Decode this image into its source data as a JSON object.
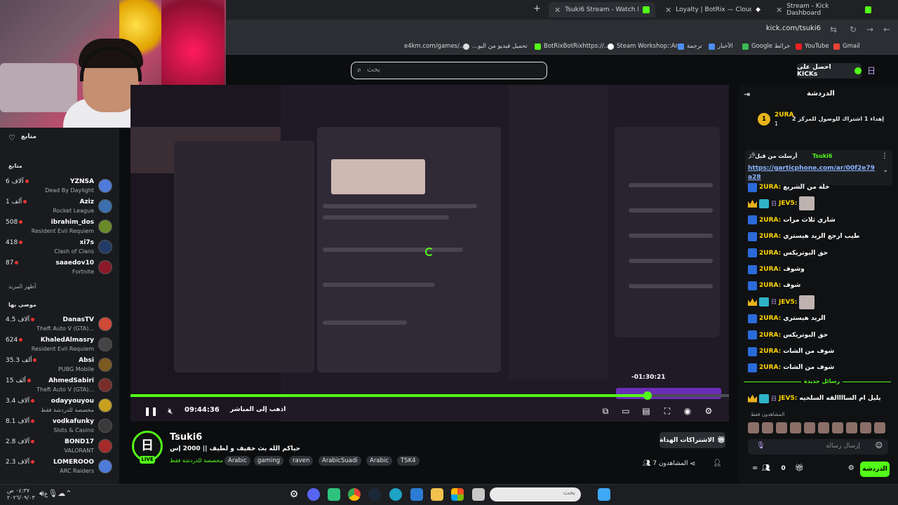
{
  "browser": {
    "tabs": [
      {
        "label": "Tsuki6 Stream - Watch Live on",
        "active": true
      },
      {
        "label": "Loyalty | BotRix — Cloud Stre",
        "active": false
      },
      {
        "label": "Stream - Kick Dashboard",
        "active": false
      }
    ],
    "url": "kick.com/tsuki6",
    "bookmarks": [
      "e4km.com/games/...",
      "...تحميل فيديو من اليو",
      "BotRixBotRixhttps://...",
      "Steam Workshop::Ar...",
      "ترجمة",
      "الأخبار",
      "Google خرائط",
      "YouTube",
      "Gmail"
    ]
  },
  "header": {
    "search_placeholder": "بحث",
    "get_kicks": "احصل على KICKs"
  },
  "sidebar": {
    "title": "متابع",
    "section_following": "متابع",
    "following": [
      {
        "name": "YZNSA",
        "count": "6 آلاف",
        "game": "Dead By Daylight"
      },
      {
        "name": "Aziz",
        "count": "1 ألف",
        "game": "Rocket League"
      },
      {
        "name": "ibrahim_dos",
        "count": "508",
        "game": "Resident Evil Requiem"
      },
      {
        "name": "xi7s",
        "count": "418",
        "game": "Clash of Clans"
      },
      {
        "name": "saaedov10",
        "count": "87",
        "game": "Fortnite"
      }
    ],
    "show_more": "أظهر المزيد",
    "section_recommended": "موصى بها",
    "recommended": [
      {
        "name": "DanasTV",
        "count": "4.5 آلاف",
        "game": "Theft Auto V (GTA)..."
      },
      {
        "name": "KhaledAlmasry",
        "count": "624",
        "game": "Resident Evil Requiem"
      },
      {
        "name": "Absi",
        "count": "35.3 ألف",
        "game": "PUBG Mobile"
      },
      {
        "name": "AhmedSabiri",
        "count": "15 ألف",
        "game": "Theft Auto V (GTA)..."
      },
      {
        "name": "odayyouyou",
        "count": "3.4 آلاف",
        "game": "مخصصة للدردشة فقط"
      },
      {
        "name": "vodkafunky",
        "count": "8.1 آلاف",
        "game": "Slots & Casino"
      },
      {
        "name": "BOND17",
        "count": "2.8 آلاف",
        "game": "VALORANT"
      },
      {
        "name": "LOMEROOO",
        "count": "2.3 آلاف",
        "game": "ARC Raiders"
      }
    ]
  },
  "player": {
    "overlay_time": "-01:30:21",
    "elapsed": "09:44:36",
    "go_live": "اذهب إلى المباشر",
    "progress": 0.864
  },
  "channel": {
    "avatar_text": "日",
    "live": "LIVE",
    "name": "Tsuki6",
    "title": "حياكم الله بث خفيف و لطيف || 2000 إس",
    "category": "مخصصة للدردشة فقط",
    "tags": [
      "Arabic",
      "gaming",
      "raven",
      "ArabicSuadi",
      "Arabic",
      "TSK4"
    ],
    "subs_button": "الاشتراكات الهداة",
    "viewers": "7 المشاهدون"
  },
  "chat": {
    "title": "الدردشة",
    "top_contrib": {
      "rank": "1",
      "name": "2URA",
      "count": "1",
      "goal": "إهداء 1 اشتراك للوصول للمركز 2"
    },
    "pinned": {
      "user": "Tsuki6",
      "by": "أرسلت من قبل",
      "link": "https://garticphone.com/ar/00f2e79a28"
    },
    "messages": [
      {
        "user": "2URA:",
        "color": "#ffd400",
        "text": "خلة من الشريع",
        "badges": [
          "sq"
        ]
      },
      {
        "user": "JEV5:",
        "color": "#ffd400",
        "text": "",
        "badges": [
          "crown",
          "og",
          "pin"
        ],
        "emote": true
      },
      {
        "user": "2URA:",
        "color": "#ffd400",
        "text": "شاري ثلاث مرات",
        "badges": [
          "sq"
        ]
      },
      {
        "user": "2URA:",
        "color": "#ffd400",
        "text": "طيب ارجع الريد هيستري",
        "badges": [
          "sq"
        ]
      },
      {
        "user": "2URA:",
        "color": "#ffd400",
        "text": "حق البوتريكس",
        "badges": [
          "sq"
        ]
      },
      {
        "user": "2URA:",
        "color": "#ffd400",
        "text": "وشوف",
        "badges": [
          "sq"
        ]
      },
      {
        "user": "2URA:",
        "color": "#ffd400",
        "text": "شوف",
        "badges": [
          "sq"
        ]
      },
      {
        "user": "JEV5:",
        "color": "#ffd400",
        "text": "",
        "badges": [
          "crown",
          "og",
          "pin"
        ],
        "emote": true
      },
      {
        "user": "2URA:",
        "color": "#ffd400",
        "text": "الريد هيستري",
        "badges": [
          "sq"
        ]
      },
      {
        "user": "2URA:",
        "color": "#ffd400",
        "text": "حق البوتريكس",
        "badges": [
          "sq"
        ]
      },
      {
        "user": "2URA:",
        "color": "#ffd400",
        "text": "شوف من الشات",
        "badges": [
          "sq"
        ]
      },
      {
        "user": "2URA:",
        "color": "#ffd400",
        "text": "شوف من الشات",
        "badges": [
          "sq"
        ]
      }
    ],
    "new_messages": "رسائل جديدة",
    "last_message": {
      "user": "JEV5:",
      "text": "يليل ام الساااالقه السلحيه"
    },
    "viewers_label": "المشاهدون فقط",
    "input_placeholder": "إرسال رسالة",
    "kicks_count": "0",
    "send": "الدردشة"
  },
  "taskbar": {
    "search_placeholder": "بحث",
    "time": "٠٤:٣٧ ص",
    "date": "٢٠٢٦/٠٩/٠٣"
  },
  "colors": {
    "kick_green": "#53fc18",
    "bg": "#0b0d0f",
    "chat_user": "#ffd400"
  }
}
